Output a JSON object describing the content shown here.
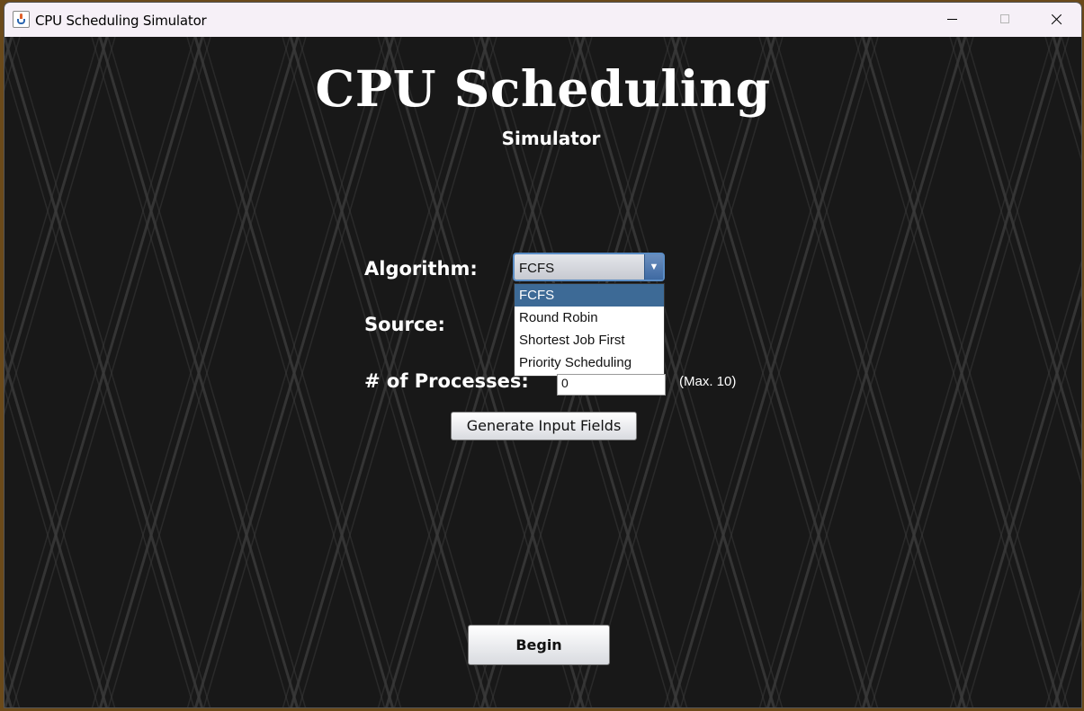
{
  "window": {
    "title": "CPU Scheduling Simulator",
    "icon": "java-cup-icon",
    "controls": [
      "minimize-icon",
      "maximize-icon",
      "close-icon"
    ]
  },
  "header": {
    "title": "CPU Scheduling",
    "subtitle": "Simulator"
  },
  "form": {
    "algorithm_label": "Algorithm:",
    "algorithm_value": "FCFS",
    "algorithm_options": [
      "FCFS",
      "Round Robin",
      "Shortest Job First",
      "Priority Scheduling"
    ],
    "source_label": "Source:",
    "processes_label": "# of Processes:",
    "processes_value": "0",
    "processes_max_note": "(Max. 10)",
    "generate_button": "Generate Input Fields",
    "begin_button": "Begin"
  },
  "colors": {
    "background": "#181818",
    "pattern_line": "#3a3a3a",
    "combo_accent": "#3d6a96",
    "selected_item": "#3d6a96"
  }
}
